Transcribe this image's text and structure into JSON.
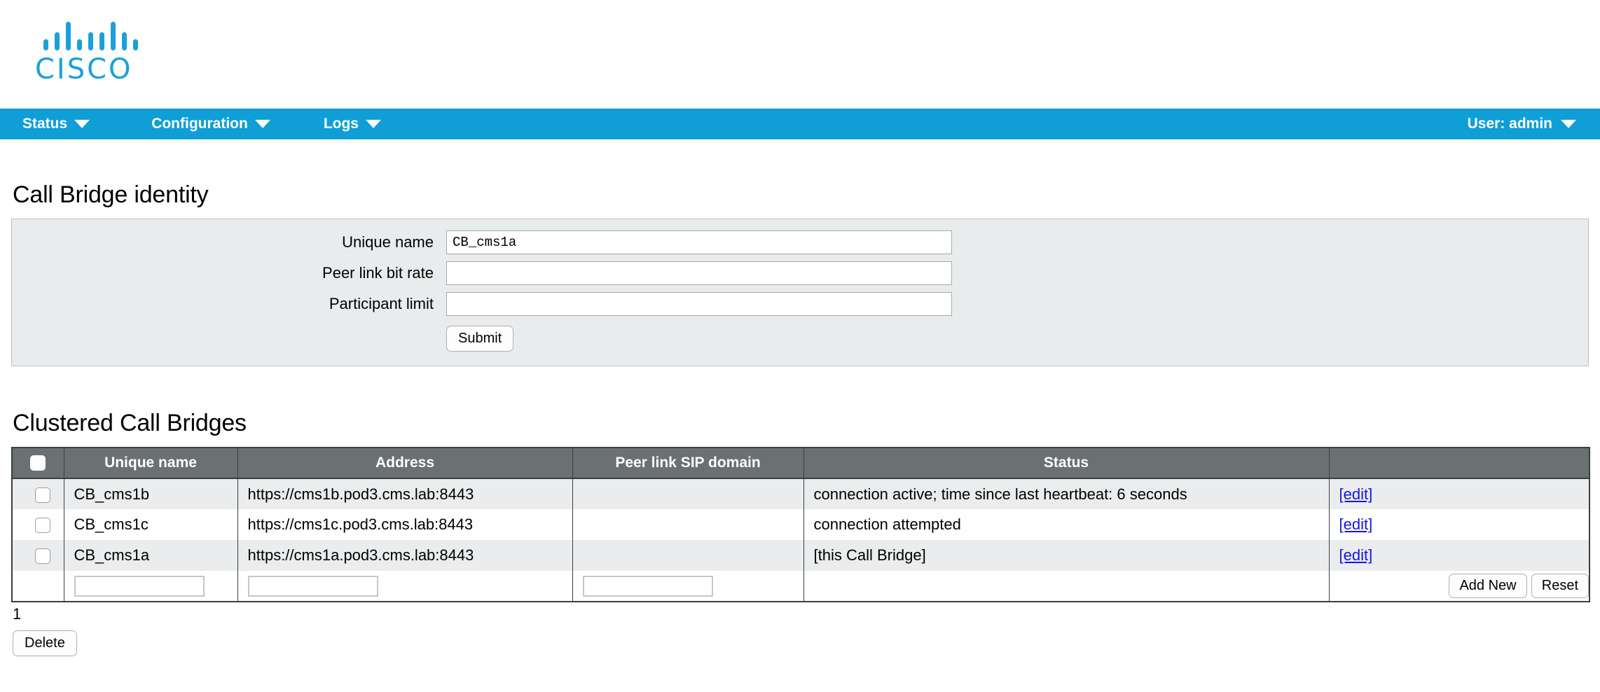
{
  "brand": {
    "name": "CISCO",
    "logo_icon": "cisco-bars-logo"
  },
  "navbar": {
    "items": [
      {
        "label": "Status",
        "icon": "chevron-down-icon"
      },
      {
        "label": "Configuration",
        "icon": "chevron-down-icon"
      },
      {
        "label": "Logs",
        "icon": "chevron-down-icon"
      }
    ],
    "user": {
      "label": "User: admin",
      "icon": "chevron-down-icon"
    }
  },
  "identity": {
    "title": "Call Bridge identity",
    "fields": [
      {
        "label": "Unique name",
        "value": "CB_cms1a"
      },
      {
        "label": "Peer link bit rate",
        "value": ""
      },
      {
        "label": "Participant limit",
        "value": ""
      }
    ],
    "submit_label": "Submit"
  },
  "cluster": {
    "title": "Clustered Call Bridges",
    "columns": [
      "",
      "Unique name",
      "Address",
      "Peer link SIP domain",
      "Status",
      ""
    ],
    "rows": [
      {
        "name": "CB_cms1b",
        "address": "https://cms1b.pod3.cms.lab:8443",
        "sip_domain": "",
        "status": "connection active; time since last heartbeat: 6 seconds",
        "edit_label": "[edit]"
      },
      {
        "name": "CB_cms1c",
        "address": "https://cms1c.pod3.cms.lab:8443",
        "sip_domain": "",
        "status": "connection attempted",
        "edit_label": "[edit]"
      },
      {
        "name": "CB_cms1a",
        "address": "https://cms1a.pod3.cms.lab:8443",
        "sip_domain": "",
        "status": "[this Call Bridge]",
        "edit_label": "[edit]"
      }
    ],
    "new_row": {
      "name_value": "",
      "address_value": "",
      "sip_value": "",
      "add_label": "Add New",
      "reset_label": "Reset"
    },
    "page_number": "1",
    "delete_label": "Delete"
  },
  "colors": {
    "brand_blue": "#0f9fd6",
    "table_header_gray": "#6b7073",
    "panel_bg": "#e9eced",
    "row_stripe": "#eaeced",
    "link_blue": "#1414e6"
  }
}
